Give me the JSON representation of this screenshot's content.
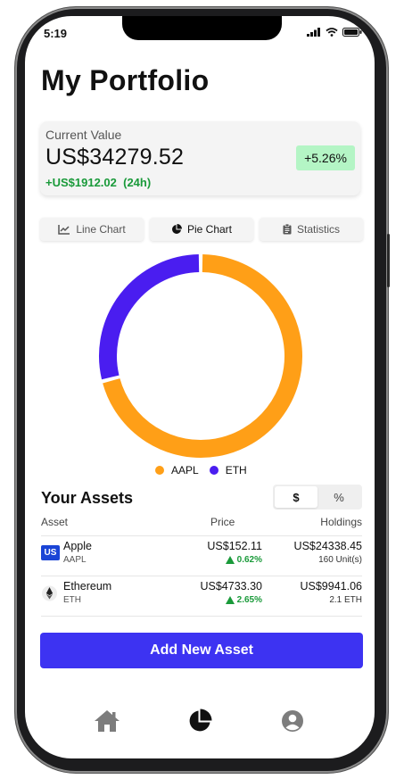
{
  "status": {
    "time": "5:19"
  },
  "page": {
    "title": "My Portfolio"
  },
  "summary": {
    "label": "Current Value",
    "value": "US$34279.52",
    "change": "+US$1912.02",
    "period": "(24h)",
    "percent_change": "+5.26%"
  },
  "tabs": [
    {
      "label": "Line Chart",
      "icon": "line-chart-icon"
    },
    {
      "label": "Pie Chart",
      "icon": "pie-chart-icon",
      "active": true
    },
    {
      "label": "Statistics",
      "icon": "clipboard-icon"
    }
  ],
  "chart_data": {
    "type": "pie",
    "style": "donut",
    "categories": [
      "AAPL",
      "ETH"
    ],
    "values": [
      24338.45,
      9941.06
    ],
    "colors": [
      "#ff9f17",
      "#4a1df0"
    ],
    "legend_position": "bottom"
  },
  "assets": {
    "title": "Your Assets",
    "toggle": [
      "$",
      "%"
    ],
    "toggle_active": "$",
    "columns": {
      "asset": "Asset",
      "price": "Price",
      "holdings": "Holdings"
    },
    "rows": [
      {
        "name": "Apple",
        "symbol": "AAPL",
        "badge": "US",
        "icon": "us-flag-icon",
        "price": "US$152.11",
        "change": "0.62%",
        "holdings": "US$24338.45",
        "units": "160 Unit(s)"
      },
      {
        "name": "Ethereum",
        "symbol": "ETH",
        "icon": "ethereum-icon",
        "price": "US$4733.30",
        "change": "2.65%",
        "holdings": "US$9941.06",
        "units": "2.1 ETH"
      }
    ]
  },
  "actions": {
    "add_asset": "Add New Asset"
  },
  "nav": [
    {
      "icon": "home-icon"
    },
    {
      "icon": "pie-chart-icon",
      "active": true
    },
    {
      "icon": "profile-icon"
    }
  ],
  "colors": {
    "accent": "#3d33f2",
    "positive": "#1a9a3a",
    "aapl": "#ff9f17",
    "eth": "#4a1df0"
  }
}
